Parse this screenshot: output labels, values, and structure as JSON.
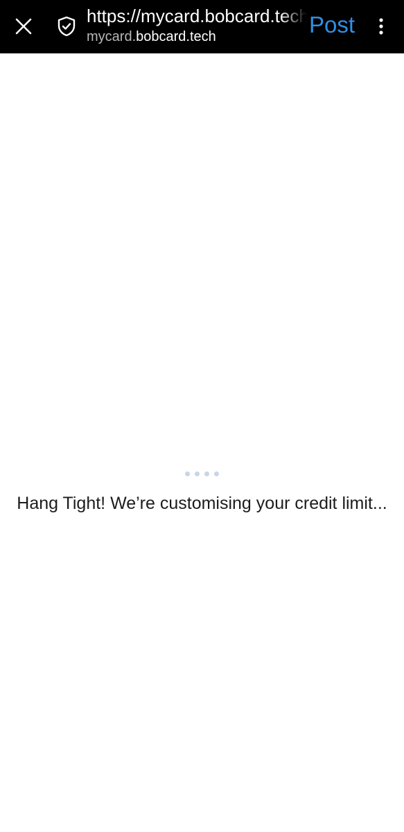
{
  "browser_bar": {
    "url_full": "https://mycard.bobcard.tech",
    "domain_prefix": "mycard.",
    "domain_main": "bobcard.tech",
    "action_label": "Post",
    "action_color": "#2f8fe6",
    "close_icon": "close-icon",
    "security_icon": "shield-check-icon",
    "menu_icon": "more-vertical-icon"
  },
  "content": {
    "loading_indicator": "four-dot-loader",
    "message": "Hang Tight! We’re customising your credit limit..."
  }
}
